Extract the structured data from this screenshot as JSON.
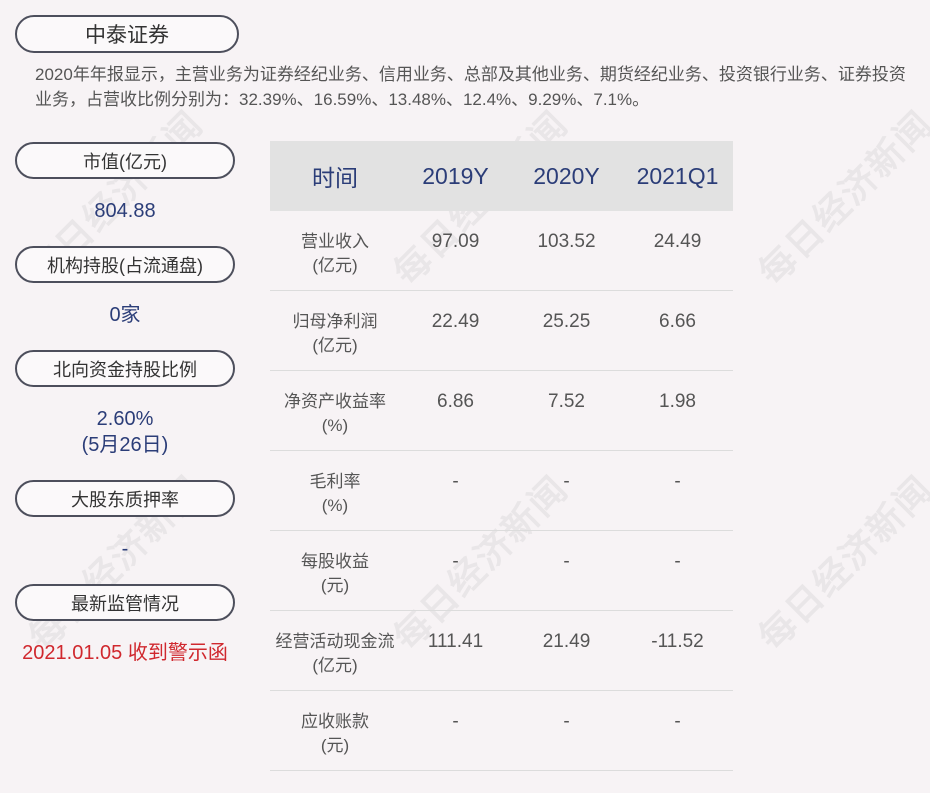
{
  "company": "中泰证券",
  "description": "2020年年报显示，主营业务为证券经纪业务、信用业务、总部及其他业务、期货经纪业务、投资银行业务、证券投资业务，占营收比例分别为：32.39%、16.59%、13.48%、12.4%、9.29%、7.1%。",
  "sidebar": [
    {
      "label": "市值(亿元)",
      "value": "804.88",
      "value2": ""
    },
    {
      "label": "机构持股(占流通盘)",
      "value": "0家",
      "value2": ""
    },
    {
      "label": "北向资金持股比例",
      "value": "2.60%",
      "value2": "(5月26日)"
    },
    {
      "label": "大股东质押率",
      "value": "-",
      "value2": ""
    },
    {
      "label": "最新监管情况",
      "value": "2021.01.05 收到警示函",
      "value2": ""
    }
  ],
  "table": {
    "headers": [
      "时间",
      "2019Y",
      "2020Y",
      "2021Q1"
    ],
    "rows": [
      {
        "label1": "营业收入",
        "label2": "(亿元)",
        "v": [
          "97.09",
          "103.52",
          "24.49"
        ]
      },
      {
        "label1": "归母净利润",
        "label2": "(亿元)",
        "v": [
          "22.49",
          "25.25",
          "6.66"
        ]
      },
      {
        "label1": "净资产收益率",
        "label2": "(%)",
        "v": [
          "6.86",
          "7.52",
          "1.98"
        ]
      },
      {
        "label1": "毛利率",
        "label2": "(%)",
        "v": [
          "-",
          "-",
          "-"
        ]
      },
      {
        "label1": "每股收益",
        "label2": "(元)",
        "v": [
          "-",
          "-",
          "-"
        ]
      },
      {
        "label1": "经营活动现金流",
        "label2": "(亿元)",
        "v": [
          "111.41",
          "21.49",
          "-11.52"
        ]
      },
      {
        "label1": "应收账款",
        "label2": "(元)",
        "v": [
          "-",
          "-",
          "-"
        ]
      }
    ]
  },
  "watermark": "每日经济新闻",
  "colors": {
    "value_blue": "#2b3d78",
    "alert_red": "#d0282e",
    "header_bg": "#e2e2e2"
  }
}
